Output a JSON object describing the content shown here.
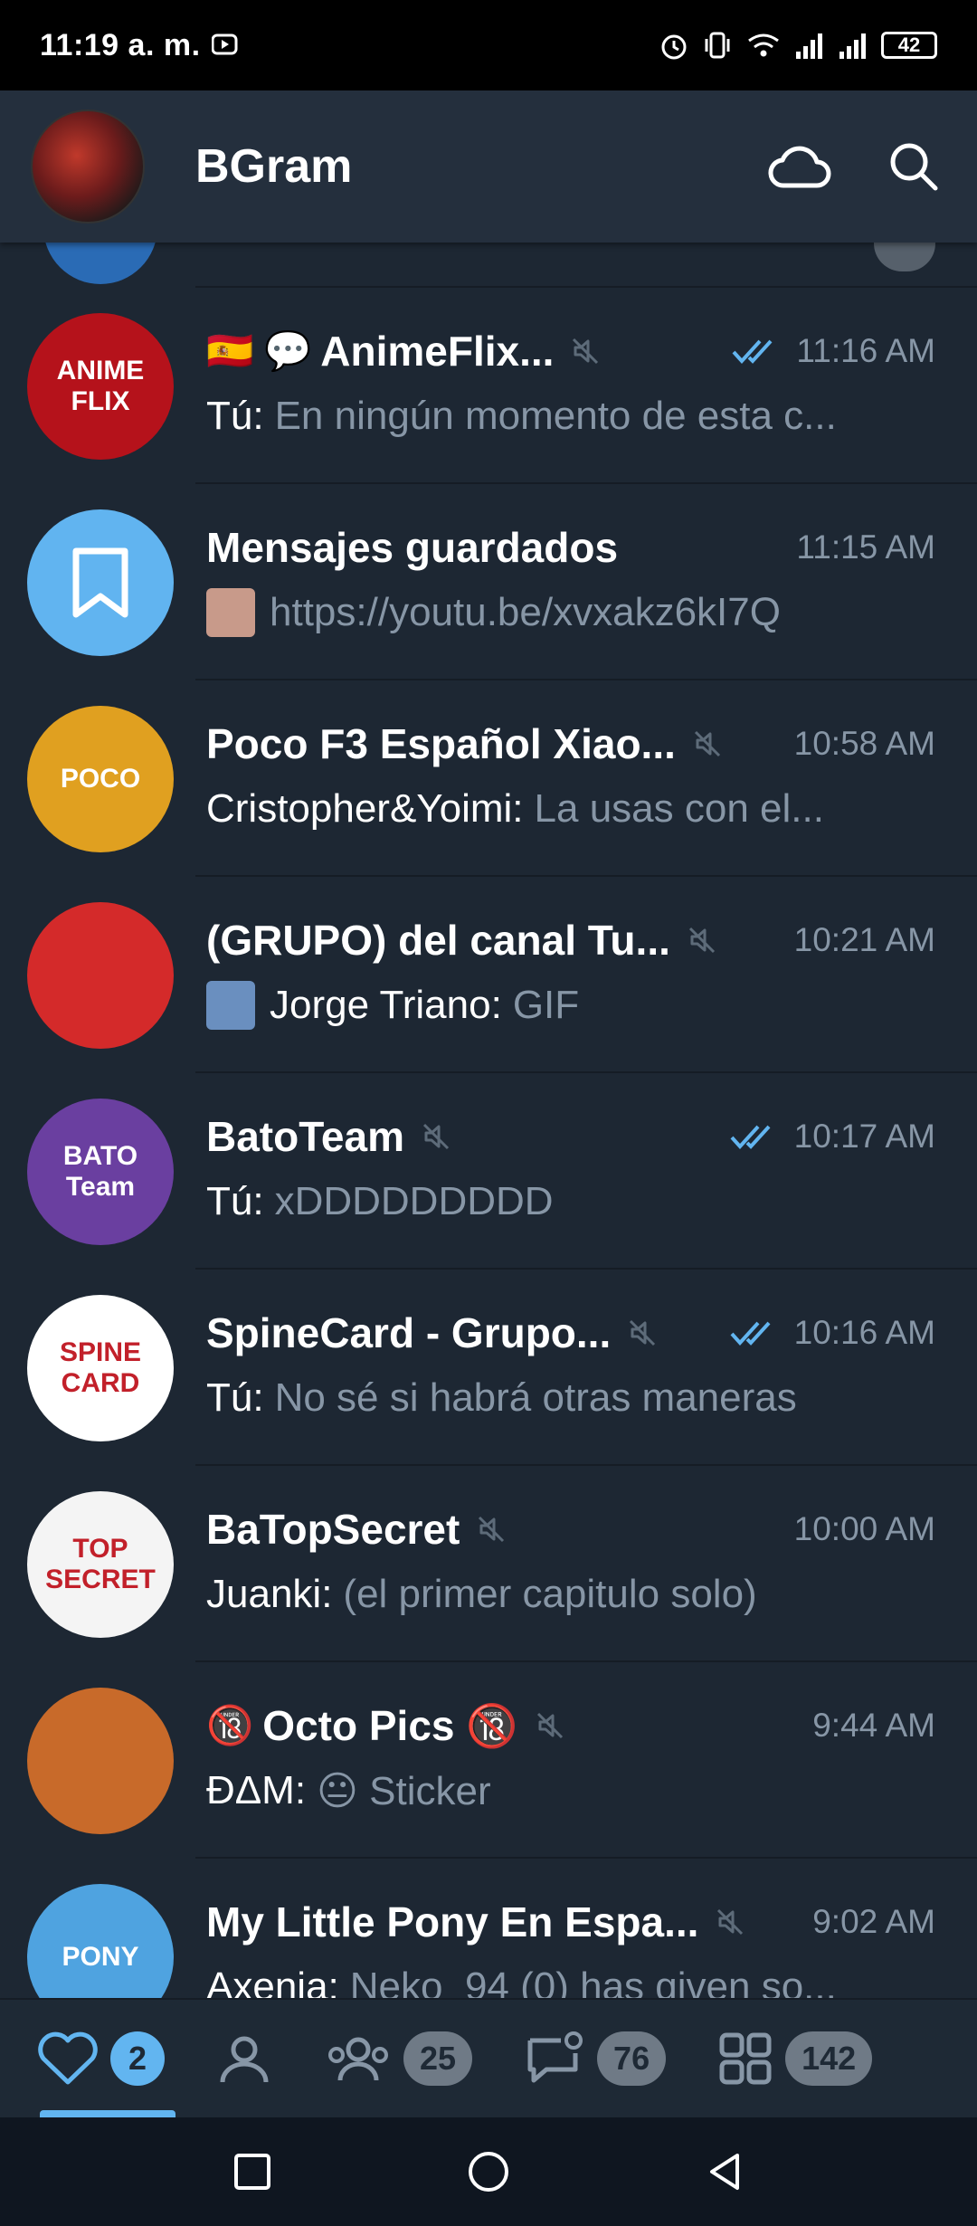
{
  "status_bar": {
    "time": "11:19 a. m.",
    "battery": "42"
  },
  "app_bar": {
    "title": "BGram"
  },
  "chats": [
    {
      "prefix": "🇪🇸 💬",
      "name": "AnimeFlix...",
      "time": "11:16 AM",
      "sender": "Tú:",
      "preview": "En ningún momento de esta c...",
      "muted": true,
      "read": true,
      "avatar_text": "ANIME FLIX",
      "avatar_color": "#b5121b"
    },
    {
      "prefix": "",
      "name": "Mensajes guardados",
      "time": "11:15 AM",
      "sender": "",
      "preview": "https://youtu.be/xvxakz6kI7Q",
      "muted": false,
      "read": false,
      "avatar_text": "",
      "avatar_color": "#61b4f0"
    },
    {
      "prefix": "",
      "name": "Poco F3 Español Xiao...",
      "time": "10:58 AM",
      "sender": "Cristopher&Yoimi:",
      "preview": "La usas con el...",
      "muted": true,
      "read": false,
      "avatar_text": "POCO",
      "avatar_color": "#e0a020"
    },
    {
      "prefix": "",
      "name": "(GRUPO) del canal Tu...",
      "time": "10:21 AM",
      "sender": "Jorge Triano:",
      "preview": "GIF",
      "muted": true,
      "read": false,
      "avatar_text": "",
      "avatar_color": "#d42a2a"
    },
    {
      "prefix": "",
      "name": "BatoTeam",
      "time": "10:17 AM",
      "sender": "Tú:",
      "preview": "xDDDDDDDDD",
      "muted": true,
      "read": true,
      "avatar_text": "BATO Team",
      "avatar_color": "#6a3fa0"
    },
    {
      "prefix": "",
      "name": "SpineCard - Grupo...",
      "time": "10:16 AM",
      "sender": "Tú:",
      "preview": "No sé si habrá otras maneras",
      "muted": true,
      "read": true,
      "avatar_text": "SPINE CARD",
      "avatar_color": "#ffffff"
    },
    {
      "prefix": "",
      "name": "BaTopSecret",
      "time": "10:00 AM",
      "sender": "Juanki:",
      "preview": "(el primer capitulo solo)",
      "muted": true,
      "read": false,
      "avatar_text": "TOP SECRET",
      "avatar_color": "#f4f4f4"
    },
    {
      "prefix": "🔞",
      "name": "Octo Pics 🔞",
      "time": "9:44 AM",
      "sender": "ĐΔM:",
      "preview": "😐 Sticker",
      "muted": true,
      "read": false,
      "avatar_text": "",
      "avatar_color": "#c86a2a"
    },
    {
      "prefix": "",
      "name": "My Little Pony En Espa...",
      "time": "9:02 AM",
      "sender": "Axenia:",
      "preview": "Neko_94 (0) has given so...",
      "muted": true,
      "read": false,
      "avatar_text": "PONY",
      "avatar_color": "#4fa3e0"
    }
  ],
  "bottom_tabs": [
    {
      "icon": "heart-icon",
      "badge": "2",
      "active": true
    },
    {
      "icon": "person-icon",
      "badge": "",
      "active": false
    },
    {
      "icon": "group-icon",
      "badge": "25",
      "active": false
    },
    {
      "icon": "chat-bubble-icon",
      "badge": "76",
      "active": false
    },
    {
      "icon": "grid-icon",
      "badge": "142",
      "active": false
    }
  ],
  "colors": {
    "background": "#1d2733",
    "header": "#242f3d",
    "accent": "#62b5f0",
    "secondary_text": "#8796a6"
  }
}
